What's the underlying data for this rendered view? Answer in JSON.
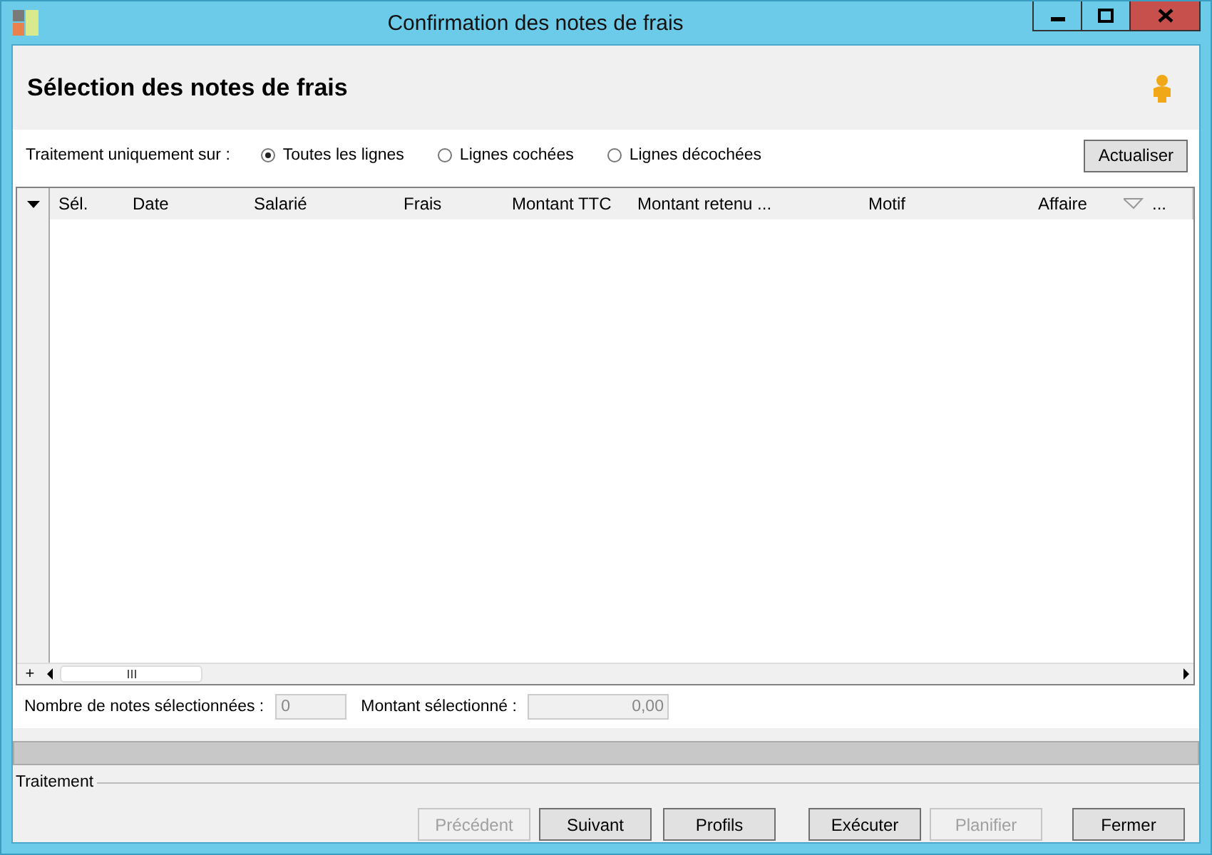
{
  "window": {
    "title": "Confirmation des notes de frais"
  },
  "header": {
    "title": "Sélection des notes de frais"
  },
  "filter": {
    "label": "Traitement uniquement sur :",
    "options": [
      {
        "label": "Toutes les lignes",
        "selected": true
      },
      {
        "label": "Lignes cochées",
        "selected": false
      },
      {
        "label": "Lignes décochées",
        "selected": false
      }
    ],
    "refresh_button": "Actualiser"
  },
  "table": {
    "columns": [
      {
        "label": "Sél."
      },
      {
        "label": "Date"
      },
      {
        "label": "Salarié"
      },
      {
        "label": "Frais"
      },
      {
        "label": "Montant TTC"
      },
      {
        "label": "Montant retenu ..."
      },
      {
        "label": "Motif"
      },
      {
        "label": "Affaire"
      }
    ],
    "more": "...",
    "expand": "+"
  },
  "summary": {
    "count_label": "Nombre de notes sélectionnées :",
    "count_value": "0",
    "amount_label": "Montant sélectionné :",
    "amount_value": "0,00"
  },
  "group_label": "Traitement",
  "buttons": [
    {
      "label": "Précédent",
      "disabled": true
    },
    {
      "label": "Suivant",
      "disabled": false
    },
    {
      "label": "Profils",
      "disabled": false
    },
    {
      "label": "Exécuter",
      "disabled": false
    },
    {
      "label": "Planifier",
      "disabled": true
    },
    {
      "label": "Fermer",
      "disabled": false
    }
  ]
}
